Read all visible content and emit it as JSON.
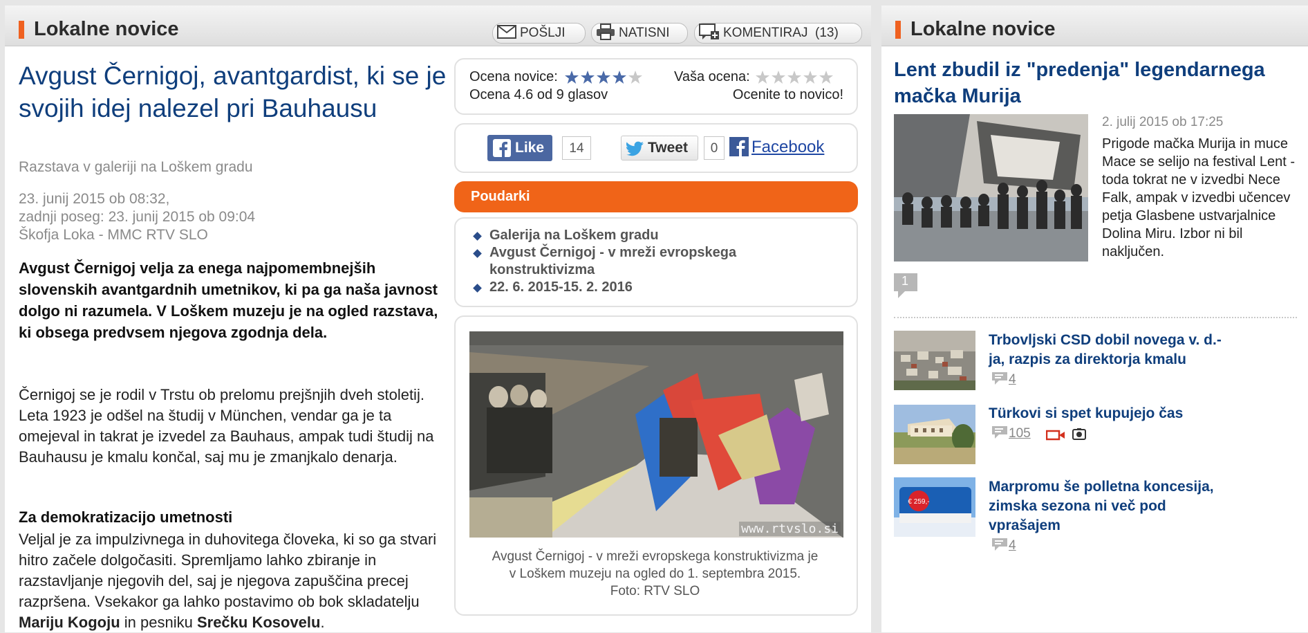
{
  "left_panel": {
    "section_title": "Lokalne novice",
    "buttons": {
      "send": "POŠLJI",
      "print": "NATISNI",
      "comment": "KOMENTIRAJ",
      "comment_count": "(13)"
    }
  },
  "article": {
    "title": "Avgust Černigoj, avantgardist, ki se je svojih idej nalezel pri Bauhausu",
    "subtitle": "Razstava v galeriji na Loškem gradu",
    "date_line": "23. junij 2015 ob 08:32,",
    "edit_line": "zadnji poseg: 23. junij 2015 ob 09:04",
    "source_line": "Škofja Loka - MMC RTV SLO",
    "lead": "Avgust Černigoj velja za enega najpomembnejših slovenskih avantgardnih umetnikov, ki pa ga naša javnost dolgo ni razumela. V Loškem muzeju je na ogled razstava, ki obsega predvsem njegova zgodnja dela.",
    "paragraph1": "Černigoj se je rodil v Trstu ob prelomu prejšnjih dveh stoletij. Leta 1923 je odšel na študij v München, vendar ga je ta omejeval in takrat je izvedel za Bauhaus, ampak tudi študij na Bauhausu je kmalu končal, saj mu je zmanjkalo denarja.",
    "heading2": "Za demokratizacijo umetnosti",
    "paragraph2_a": "Veljal je za impulzivnega in duhovitega človeka, ki so ga stvari hitro začele dolgočasiti. Spremljamo lahko zbiranje in razstavljanje njegovih del, saj je njegova zapuščina precej razpršena. Vsekakor ga lahko postavimo ob bok skladatelju ",
    "paragraph2_bold1": "Mariju Kogoju",
    "paragraph2_mid": " in pesniku ",
    "paragraph2_bold2": "Srečku Kosovelu",
    "paragraph2_end": "."
  },
  "rating": {
    "label": "Ocena novice:",
    "summary": "Ocena 4.6 od 9 glasov",
    "value": 4.6,
    "max": 5,
    "your_label": "Vaša ocena:",
    "your_prompt": "Ocenite to novico!"
  },
  "social": {
    "like_label": "Like",
    "like_count": "14",
    "tweet_label": "Tweet",
    "tweet_count": "0",
    "facebook_label": "Facebook"
  },
  "highlights": {
    "title": "Poudarki",
    "items": [
      "Galerija na Loškem gradu",
      "Avgust Černigoj - v mreži evropskega",
      "konstruktivizma",
      "22. 6. 2015-15. 2. 2016"
    ]
  },
  "photo": {
    "watermark": "www.rtvslo.si",
    "caption_line1": "Avgust Černigoj - v mreži evropskega konstruktivizma je",
    "caption_line2": "v Loškem muzeju na ogled do 1. septembra 2015.",
    "caption_line3": "Foto: RTV SLO"
  },
  "right_panel": {
    "section_title": "Lokalne novice",
    "featured": {
      "title": "Lent zbudil iz \"predenja\" legendarnega mačka Murija",
      "date": "2. julij 2015 ob 17:25",
      "text": "Prigode mačka Murija in muce Mace se selijo na festival Lent - toda tokrat ne v izvedbi Nece Falk, ampak v izvedbi učencev petja Glasbene ustvarjalnice Dolina Miru. Izbor ni bil naključen.",
      "comments": "1"
    },
    "news": [
      {
        "title_line1": "Trbovljski CSD dobil novega v. d.-",
        "title_line2": "ja, razpis za direktorja kmalu",
        "comments": "4"
      },
      {
        "title_line1": "Türkovi si spet kupujejo čas",
        "comments": "105"
      },
      {
        "title_line1": "Marpromu še polletna koncesija,",
        "title_line2": "zimska sezona ni več pod",
        "title_line3": "vprašajem",
        "comments": "4",
        "thumb_price": "€ 259,-"
      }
    ]
  },
  "colors": {
    "accent_orange": "#f06418",
    "title_blue": "#0f3e7c",
    "facebook_blue": "#4b67a1",
    "star_blue": "#4a6aa8"
  }
}
